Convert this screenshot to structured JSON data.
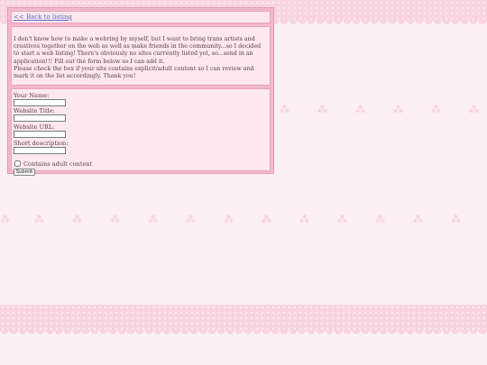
{
  "nav": {
    "back_link": "<< Back to listing"
  },
  "intro": {
    "paragraph_1": "I don't know how to make a webring by myself, but I want to bring trans artists and creatives together on the web as well as make friends in the community...so I decided to start a web listing! There's obviously no sites currently listed yet, so...send in an application!!! Fill out the form below so I can add it.",
    "paragraph_2": "Please check the box if your site contains explicit/adult content so I can review and mark it on the list accordingly. Thank you!"
  },
  "form": {
    "name_label": "Your Name:",
    "name_value": "",
    "title_label": "Website Title:",
    "title_value": "",
    "url_label": "Website URL:",
    "url_value": "",
    "description_label": "Short description:",
    "description_value": "",
    "adult_label": "Contains adult content",
    "adult_checked": false,
    "submit_label": "Submit"
  },
  "decor": {
    "bow_glyph": "🎀",
    "colors": {
      "background": "#fdf0f5",
      "band": "#f7d3df",
      "panel": "#f4b8cb",
      "box": "#fde8ef",
      "link": "#5b6fc8"
    }
  }
}
